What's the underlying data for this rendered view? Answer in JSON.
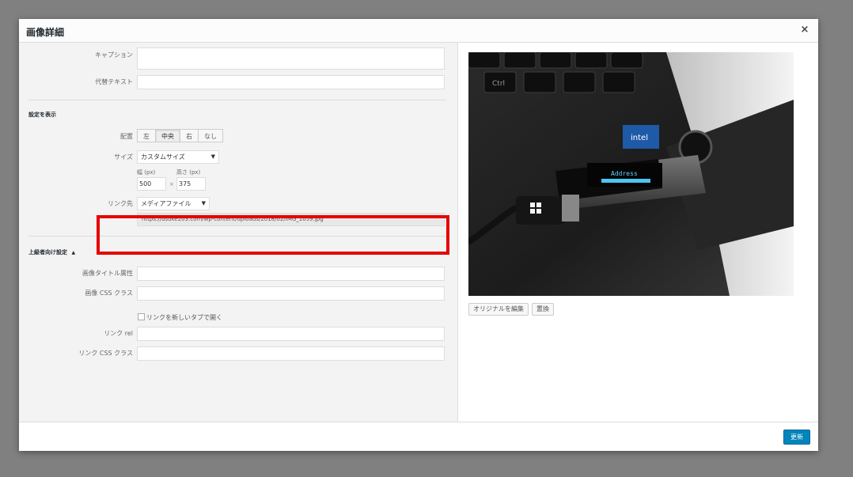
{
  "modal": {
    "title": "画像詳細",
    "close_label": "×"
  },
  "fields": {
    "caption_label": "キャプション",
    "caption_value": "",
    "alt_label": "代替テキスト",
    "alt_value": ""
  },
  "display_settings": {
    "section_title": "設定を表示",
    "align_label": "配置",
    "align_options": [
      "左",
      "中央",
      "右",
      "なし"
    ],
    "align_selected": "中央",
    "size_label": "サイズ",
    "size_value": "カスタムサイズ",
    "width_label": "幅 (px)",
    "width_value": "500",
    "height_label": "高さ (px)",
    "height_value": "375",
    "times_sign": "×",
    "link_label": "リンク先",
    "link_value": "メディアファイル",
    "link_url": "https://dsuke203.com/wp-content/uploads/2018/02/IMG_1059.jpg"
  },
  "advanced": {
    "section_title": "上級者向け設定",
    "toggle_icon": "▲",
    "title_attr_label": "画像タイトル属性",
    "title_attr_value": "",
    "css_class_label": "画像 CSS クラス",
    "css_class_value": "",
    "new_tab_label": "リンクを新しいタブで開く",
    "new_tab_checked": false,
    "link_rel_label": "リンク rel",
    "link_rel_value": "",
    "link_css_label": "リンク CSS クラス",
    "link_css_value": ""
  },
  "preview": {
    "edit_original_label": "オリジナルを編集",
    "replace_label": "置換",
    "image_text_address": "Address",
    "image_text_brand": "intel",
    "image_text_ctrl": "Ctrl"
  },
  "footer": {
    "update_label": "更新"
  },
  "colors": {
    "highlight": "#e60000",
    "primary": "#0085ba",
    "overlay": "#808080"
  }
}
